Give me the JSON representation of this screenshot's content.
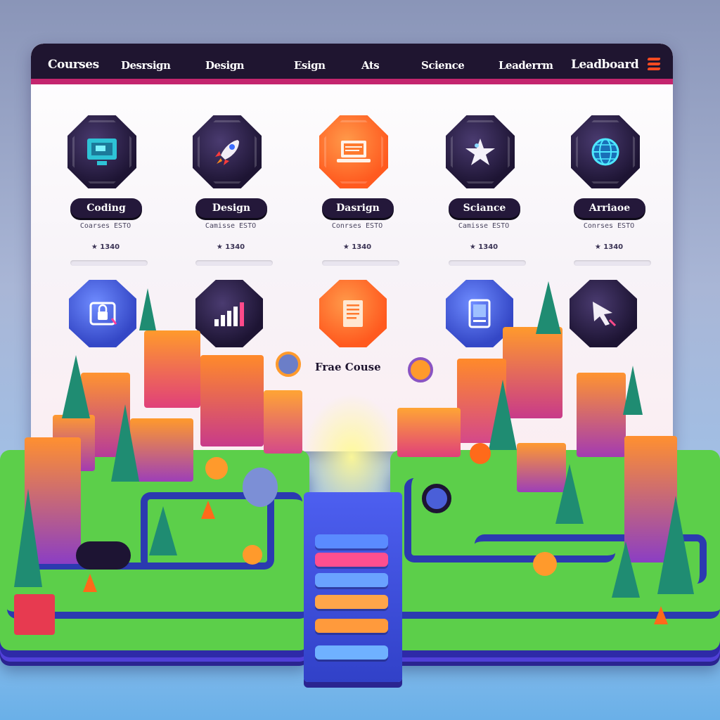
{
  "nav": {
    "items": [
      "Courses",
      "Desrsign",
      "Design",
      "Esign",
      "Ats",
      "Science",
      "Leaderrm",
      "Leadboard"
    ]
  },
  "courses_row1": [
    {
      "title": "Coding",
      "meta": "Coarses ESTO",
      "rating": "★ 1340",
      "color": "dark",
      "icon": "monitor-icon"
    },
    {
      "title": "Design",
      "meta": "Camisse ESTO",
      "rating": "★ 1340",
      "color": "dark",
      "icon": "rocket-icon"
    },
    {
      "title": "Dasrign",
      "meta": "Conrses ESTO",
      "rating": "★ 1340",
      "color": "orange",
      "icon": "laptop-icon"
    },
    {
      "title": "Sciance",
      "meta": "Camisse ESTO",
      "rating": "★ 1340",
      "color": "dark",
      "icon": "star-icon"
    },
    {
      "title": "Arriaoe",
      "meta": "Conrses ESTO",
      "rating": "★ 1340",
      "color": "dark",
      "icon": "globe-icon"
    }
  ],
  "courses_row2": [
    {
      "color": "blue",
      "icon": "lock-icon"
    },
    {
      "color": "dark",
      "icon": "bar-chart-icon"
    },
    {
      "color": "orange",
      "icon": "document-icon"
    },
    {
      "color": "blue",
      "icon": "tablet-icon"
    },
    {
      "color": "dark",
      "icon": "cursor-icon"
    }
  ],
  "free_course_label": "Frae Couse",
  "bridge_buttons": [
    {
      "label": "",
      "color": "#5a8bff"
    },
    {
      "label": "",
      "color": "#ff4f8f"
    },
    {
      "label": "",
      "color": "#6aa2ff"
    },
    {
      "label": "",
      "color": "#ffa54a"
    },
    {
      "label": "",
      "color": "#ff9a3c"
    },
    {
      "label": "",
      "color": "#6fb1ff"
    }
  ],
  "colors": {
    "navbar": "#1f1530",
    "accent": "#c4256e",
    "grass": "#5ccf4a",
    "path": "#2b3ab0"
  }
}
